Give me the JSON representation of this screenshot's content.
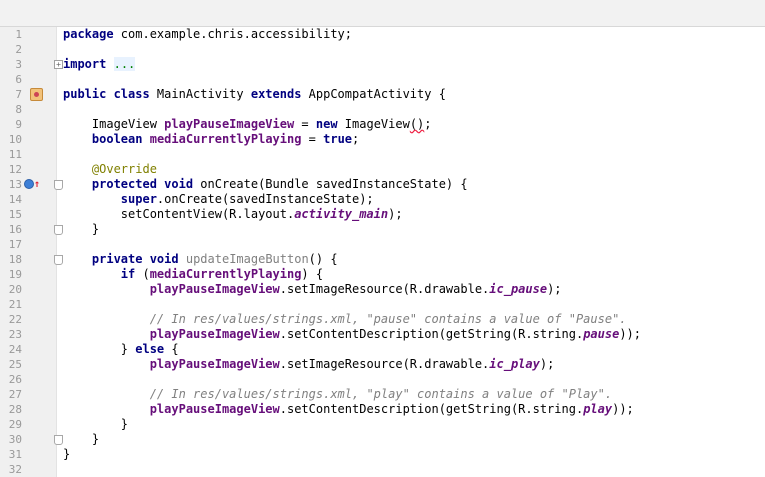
{
  "editor": {
    "lines": [
      {
        "n": "1",
        "t": [
          [
            "kw",
            "package"
          ],
          [
            "p",
            " com.example.chris.accessibility;"
          ]
        ]
      },
      {
        "n": "2",
        "t": []
      },
      {
        "n": "3",
        "t": [
          [
            "kw",
            "import"
          ],
          [
            "p",
            " "
          ],
          [
            "folded",
            "..."
          ]
        ],
        "fold": "plus"
      },
      {
        "n": "6",
        "t": []
      },
      {
        "n": "7",
        "t": [
          [
            "kw",
            "public class"
          ],
          [
            "p",
            " MainActivity "
          ],
          [
            "kw",
            "extends"
          ],
          [
            "p",
            " AppCompatActivity {"
          ]
        ],
        "icon": "class"
      },
      {
        "n": "8",
        "t": []
      },
      {
        "n": "9",
        "t": [
          [
            "p",
            "    ImageView "
          ],
          [
            "fld",
            "playPauseImageView"
          ],
          [
            "p",
            " = "
          ],
          [
            "kw",
            "new"
          ],
          [
            "p",
            " ImageView"
          ],
          [
            "squig",
            "()"
          ],
          [
            "p",
            ";"
          ]
        ]
      },
      {
        "n": "10",
        "t": [
          [
            "p",
            "    "
          ],
          [
            "kw",
            "boolean"
          ],
          [
            "p",
            " "
          ],
          [
            "fld",
            "mediaCurrentlyPlaying"
          ],
          [
            "p",
            " = "
          ],
          [
            "kw",
            "true"
          ],
          [
            "p",
            ";"
          ]
        ]
      },
      {
        "n": "11",
        "t": []
      },
      {
        "n": "12",
        "t": [
          [
            "p",
            "    "
          ],
          [
            "ann",
            "@Override"
          ]
        ]
      },
      {
        "n": "13",
        "t": [
          [
            "p",
            "    "
          ],
          [
            "kw",
            "protected void"
          ],
          [
            "p",
            " onCreate(Bundle savedInstanceState) {"
          ]
        ],
        "icon": "override",
        "fold": "minus"
      },
      {
        "n": "14",
        "t": [
          [
            "p",
            "        "
          ],
          [
            "kw",
            "super"
          ],
          [
            "p",
            ".onCreate(savedInstanceState);"
          ]
        ]
      },
      {
        "n": "15",
        "t": [
          [
            "p",
            "        setContentView(R.layout."
          ],
          [
            "sfld",
            "activity_main"
          ],
          [
            "p",
            ");"
          ]
        ]
      },
      {
        "n": "16",
        "t": [
          [
            "p",
            "    }"
          ]
        ],
        "fold": "end"
      },
      {
        "n": "17",
        "t": []
      },
      {
        "n": "18",
        "t": [
          [
            "p",
            "    "
          ],
          [
            "kw",
            "private void"
          ],
          [
            "p",
            " "
          ],
          [
            "unused",
            "updateImageButton"
          ],
          [
            "p",
            "() {"
          ]
        ],
        "fold": "minus"
      },
      {
        "n": "19",
        "t": [
          [
            "p",
            "        "
          ],
          [
            "kw",
            "if"
          ],
          [
            "p",
            " ("
          ],
          [
            "fld",
            "mediaCurrentlyPlaying"
          ],
          [
            "p",
            ") {"
          ]
        ]
      },
      {
        "n": "20",
        "t": [
          [
            "p",
            "            "
          ],
          [
            "fld",
            "playPauseImageView"
          ],
          [
            "p",
            ".setImageResource(R.drawable."
          ],
          [
            "sfld",
            "ic_pause"
          ],
          [
            "p",
            ");"
          ]
        ]
      },
      {
        "n": "21",
        "t": []
      },
      {
        "n": "22",
        "t": [
          [
            "p",
            "            "
          ],
          [
            "cmt",
            "// In res/values/strings.xml, \"pause\" contains a value of \"Pause\"."
          ]
        ]
      },
      {
        "n": "23",
        "t": [
          [
            "p",
            "            "
          ],
          [
            "fld",
            "playPauseImageView"
          ],
          [
            "p",
            ".setContentDescription(getString(R.string."
          ],
          [
            "sfld",
            "pause"
          ],
          [
            "p",
            "));"
          ]
        ]
      },
      {
        "n": "24",
        "t": [
          [
            "p",
            "        } "
          ],
          [
            "kw",
            "else"
          ],
          [
            "p",
            " {"
          ]
        ]
      },
      {
        "n": "25",
        "t": [
          [
            "p",
            "            "
          ],
          [
            "fld",
            "playPauseImageView"
          ],
          [
            "p",
            ".setImageResource(R.drawable."
          ],
          [
            "sfld",
            "ic_play"
          ],
          [
            "p",
            ");"
          ]
        ]
      },
      {
        "n": "26",
        "t": []
      },
      {
        "n": "27",
        "t": [
          [
            "p",
            "            "
          ],
          [
            "cmt",
            "// In res/values/strings.xml, \"play\" contains a value of \"Play\"."
          ]
        ]
      },
      {
        "n": "28",
        "t": [
          [
            "p",
            "            "
          ],
          [
            "fld",
            "playPauseImageView"
          ],
          [
            "p",
            ".setContentDescription(getString(R.string."
          ],
          [
            "sfld",
            "play"
          ],
          [
            "p",
            "));"
          ]
        ]
      },
      {
        "n": "29",
        "t": [
          [
            "p",
            "        }"
          ]
        ]
      },
      {
        "n": "30",
        "t": [
          [
            "p",
            "    }"
          ]
        ],
        "fold": "end"
      },
      {
        "n": "31",
        "t": [
          [
            "p",
            "}"
          ]
        ]
      },
      {
        "n": "32",
        "t": []
      }
    ]
  }
}
